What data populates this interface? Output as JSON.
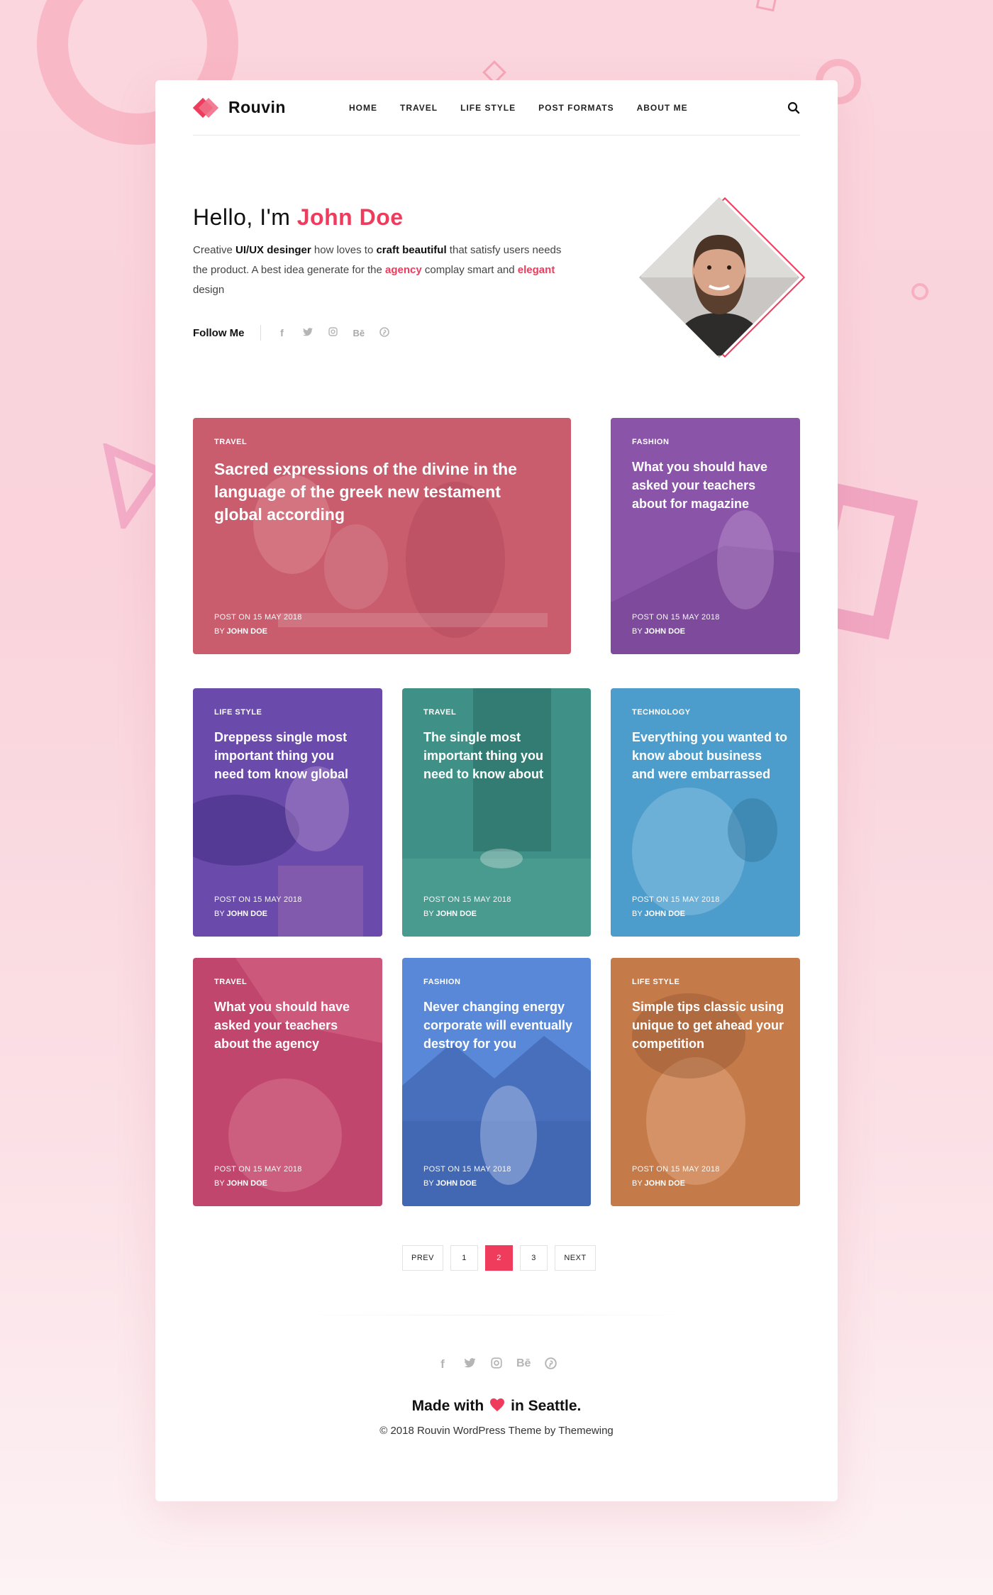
{
  "brand": {
    "name": "Rouvin",
    "accent": "#ef3b5c"
  },
  "nav": [
    "HOME",
    "TRAVEL",
    "LIFE STYLE",
    "POST FORMATS",
    "ABOUT ME"
  ],
  "hero": {
    "greeting": "Hello, I'm",
    "name": "John Doe",
    "bio": {
      "p1": "Creative ",
      "b1": "UI/UX desinger",
      "p2": " how loves to ",
      "b2": "craft beautiful",
      "p3": " that satisfy  users needs the product. A best idea generate for the ",
      "k1": "agency",
      "p4": " complay smart and ",
      "k2": "elegant",
      "p5": " design"
    },
    "follow_label": "Follow Me",
    "social_icons": [
      "facebook-icon",
      "twitter-icon",
      "instagram-icon",
      "behance-icon",
      "pinterest-icon"
    ]
  },
  "posts": [
    {
      "category": "TRAVEL",
      "title": "Sacred expressions of the divine in the language of the greek new testament global according",
      "date": "POST ON 15 MAY 2018",
      "by": "BY",
      "author": "JOHN DOE",
      "color": "#c95c6d"
    },
    {
      "category": "FASHION",
      "title": "What you should have asked your teachers about for magazine",
      "date": "POST ON 15 MAY 2018",
      "by": "BY",
      "author": "JOHN DOE",
      "color": "#8a55a9"
    },
    {
      "category": "LIFE STYLE",
      "title": "Dreppess single most important thing you need tom know global",
      "date": "POST ON 15 MAY 2018",
      "by": "BY",
      "author": "JOHN DOE",
      "color": "#6a4aab"
    },
    {
      "category": "TRAVEL",
      "title": "The single most important thing you need to know about",
      "date": "POST ON 15 MAY 2018",
      "by": "BY",
      "author": "JOHN DOE",
      "color": "#3f9187"
    },
    {
      "category": "TECHNOLOGY",
      "title": "Everything you wanted to know about business and were embarrassed",
      "date": "POST ON 15 MAY 2018",
      "by": "BY",
      "author": "JOHN DOE",
      "color": "#4c9dcc"
    },
    {
      "category": "TRAVEL",
      "title": "What you should have asked your teachers about the agency",
      "date": "POST ON 15 MAY 2018",
      "by": "BY",
      "author": "JOHN DOE",
      "color": "#c1466d"
    },
    {
      "category": "FASHION",
      "title": "Never changing energy corporate  will eventually destroy for you",
      "date": "POST ON 15 MAY 2018",
      "by": "BY",
      "author": "JOHN DOE",
      "color": "#5a88d9"
    },
    {
      "category": "LIFE STYLE",
      "title": "Simple tips classic using unique to get ahead your competition",
      "date": "POST ON 15 MAY 2018",
      "by": "BY",
      "author": "JOHN DOE",
      "color": "#c47a49"
    }
  ],
  "pagination": {
    "prev": "PREV",
    "pages": [
      "1",
      "2",
      "3"
    ],
    "active": "2",
    "next": "NEXT"
  },
  "footer": {
    "social_icons": [
      "facebook-icon",
      "twitter-icon",
      "instagram-icon",
      "behance-icon",
      "pinterest-icon"
    ],
    "made_prefix": "Made with",
    "made_suffix": "in Seattle.",
    "copyright": "© 2018 Rouvin WordPress Theme by Themewing"
  }
}
